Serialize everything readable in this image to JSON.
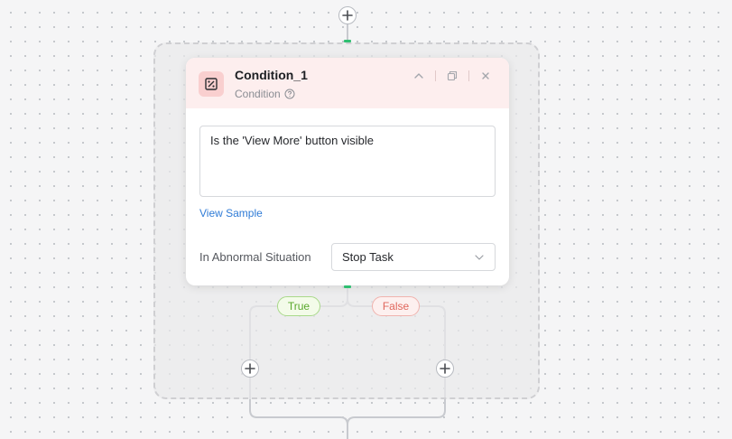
{
  "node": {
    "title": "Condition_1",
    "type_label": "Condition",
    "condition_text": "Is the 'View More' button visible",
    "view_sample_label": "View Sample",
    "abnormal_label": "In Abnormal Situation",
    "abnormal_value": "Stop Task"
  },
  "branches": {
    "true_label": "True",
    "false_label": "False"
  },
  "colors": {
    "canvas": "#f5f5f6",
    "header_bg": "#fdeeee",
    "badge_bg": "#f9cfcf",
    "link": "#2f7bd6",
    "port": "#2fbf71",
    "true": "#5aa82c",
    "false": "#e0665c"
  },
  "icons": [
    "plus-icon",
    "condition-icon",
    "help-icon",
    "chevron-up-icon",
    "copy-icon",
    "close-icon",
    "chevron-down-icon"
  ]
}
